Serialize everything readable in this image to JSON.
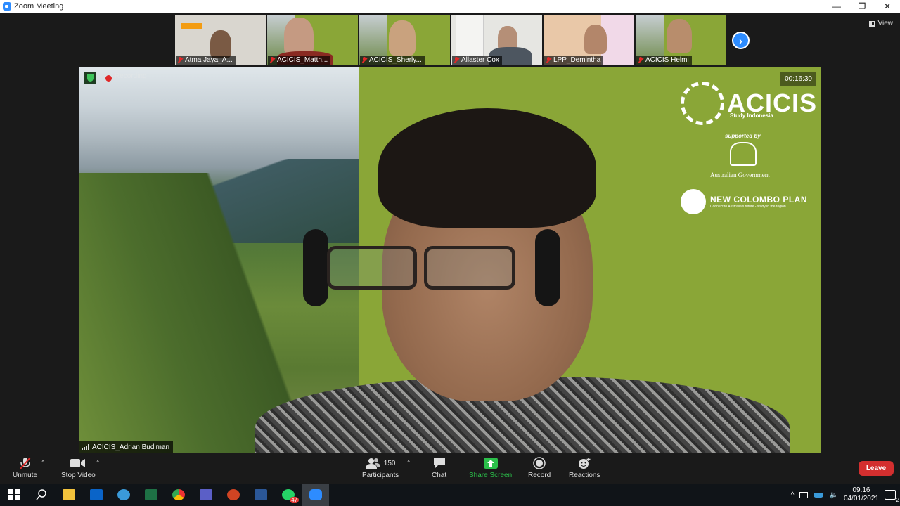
{
  "window": {
    "title": "Zoom Meeting",
    "min": "—",
    "restore": "❐",
    "close": "✕"
  },
  "gallery": {
    "thumbnails": [
      {
        "name": "Atma Jaya_A...",
        "bg": "#d9d6cf",
        "muted": true
      },
      {
        "name": "ACICIS_Matth...",
        "bg": "#8aa637",
        "muted": true
      },
      {
        "name": "ACICIS_Sherly...",
        "bg": "#8aa637",
        "muted": true
      },
      {
        "name": "Allaster Cox",
        "bg": "#e6e6e2",
        "muted": true
      },
      {
        "name": "LPP_Demintha",
        "bg": "#e9c8a8",
        "muted": true
      },
      {
        "name": "ACICIS Helmi",
        "bg": "#8aa637",
        "muted": true
      }
    ],
    "next_icon": "chevron-right-icon",
    "view_label": "View"
  },
  "main": {
    "recording_label": "Recording",
    "timer": "00:16:30",
    "background_color": "#8aa637",
    "logo": {
      "brand": "ACICIS",
      "tagline": "Study Indonesia",
      "supported_by": "supported by",
      "government": "Australian Government",
      "program": "NEW COLOMBO PLAN",
      "program_tagline": "Connect to Australia's future - study in the region"
    },
    "speaker_name": "ACICIS_Adrian Budiman"
  },
  "toolbar": {
    "unmute": "Unmute",
    "stop_video": "Stop Video",
    "participants": "Participants",
    "participant_count": "150",
    "chat": "Chat",
    "share_screen": "Share Screen",
    "record": "Record",
    "reactions": "Reactions",
    "leave": "Leave",
    "share_color": "#2bbf4a",
    "leave_color": "#d32f2f"
  },
  "taskbar": {
    "apps": [
      "windows-start-icon",
      "search-icon",
      "file-explorer-icon",
      "outlook-icon",
      "edge-icon",
      "excel-icon",
      "chrome-icon",
      "teams-icon",
      "powerpoint-icon",
      "word-icon",
      "whatsapp-icon",
      "zoom-icon"
    ],
    "whatsapp_badge": "47",
    "time": "09.16",
    "date": "04/01/2021",
    "notification_count": "2"
  }
}
